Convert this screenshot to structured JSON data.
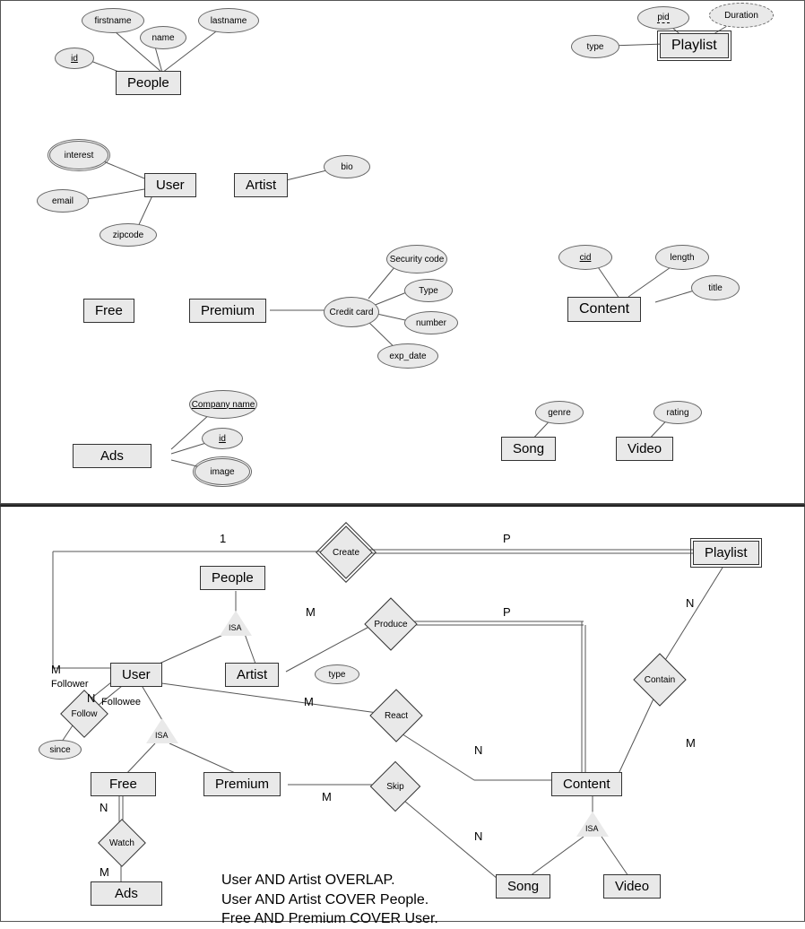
{
  "top": {
    "people": {
      "label": "People",
      "id": "id",
      "name": "name",
      "firstname": "firstname",
      "lastname": "lastname"
    },
    "playlist": {
      "label": "Playlist",
      "pid": "pid",
      "duration": "Duration",
      "type": "type"
    },
    "user": {
      "label": "User",
      "interest": "interest",
      "email": "email",
      "zipcode": "zipcode"
    },
    "artist": {
      "label": "Artist",
      "bio": "bio"
    },
    "free": {
      "label": "Free"
    },
    "premium": {
      "label": "Premium",
      "creditcard": "Credit card",
      "security": "Security code",
      "type": "Type",
      "number": "number",
      "expdate": "exp_date"
    },
    "content": {
      "label": "Content",
      "cid": "cid",
      "length": "length",
      "title": "title"
    },
    "ads": {
      "label": "Ads",
      "company": "Company name",
      "id": "id",
      "image": "image"
    },
    "song": {
      "label": "Song",
      "genre": "genre"
    },
    "video": {
      "label": "Video",
      "rating": "rating"
    }
  },
  "bot": {
    "people": "People",
    "playlist": "Playlist",
    "user": "User",
    "artist": "Artist",
    "free": "Free",
    "premium": "Premium",
    "content": "Content",
    "song": "Song",
    "video": "Video",
    "ads": "Ads",
    "isa": "ISA",
    "create": "Create",
    "produce": "Produce",
    "react": "React",
    "reacttype": "type",
    "skip": "Skip",
    "contain": "Contain",
    "follow": "Follow",
    "follower": "Follower",
    "followee": "Followee",
    "since": "since",
    "watch": "Watch",
    "card1": "1",
    "cardP": "P",
    "cardM": "M",
    "cardN": "N",
    "notes": {
      "l1": "User AND Artist OVERLAP.",
      "l2": "User AND Artist COVER People.",
      "l3": "Free AND Premium COVER User."
    }
  }
}
